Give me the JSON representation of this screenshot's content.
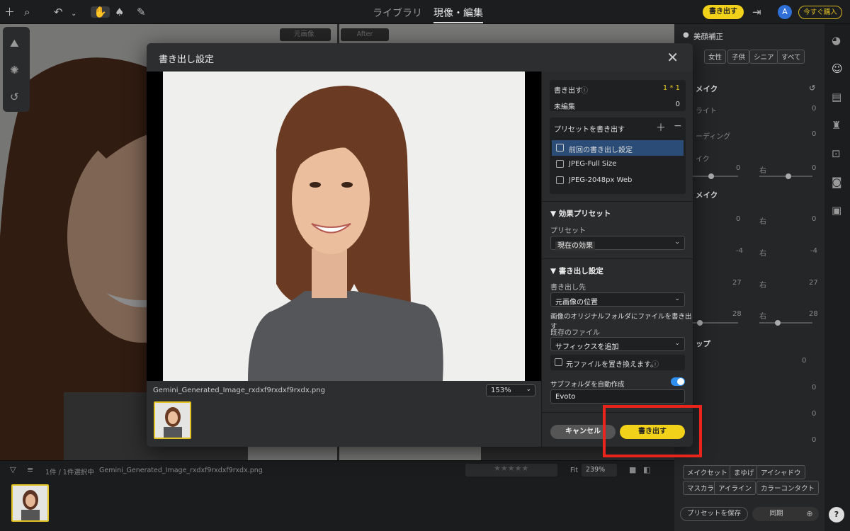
{
  "toolbar": {
    "tabs": [
      "ライブラリ",
      "現像・編集"
    ],
    "export_label": "書き出す",
    "avatar_letter": "A",
    "buy_label": "今すぐ購入"
  },
  "canvas": {
    "before_label": "元画像",
    "after_label": "After"
  },
  "dialog": {
    "title": "書き出し設定",
    "filename": "Gemini_Generated_Image_rxdxf9rxdxf9rxdx.png",
    "zoom": "153%",
    "export_count_label": "書き出す",
    "export_count_value": "1 * 1",
    "unedited_label": "未編集",
    "unedited_value": "0",
    "preset_header": "プリセットを書き出す",
    "presets": [
      "前回の書き出し設定",
      "JPEG-Full Size",
      "JPEG-2048px Web"
    ],
    "effect_section": "効果プリセット",
    "preset_label": "プリセット",
    "preset_value": "現在の効果",
    "export_section": "書き出し設定",
    "destination_label": "書き出し先",
    "destination_value": "元画像の位置",
    "destination_desc": "画像のオリジナルフォルダにファイルを書き出す",
    "existing_label": "既存のファイル",
    "existing_value": "サフィックスを追加",
    "overwrite_label": "元ファイルを置き換えます。",
    "subfolder_label": "サブフォルダを自動作成",
    "subfolder_value": "Evoto",
    "cancel": "キャンセル",
    "export": "書き出す"
  },
  "right_panel": {
    "title": "美顔補正",
    "chips": [
      "女性",
      "子供",
      "シニア",
      "すべて"
    ],
    "section1": "メイク",
    "rows": [
      {
        "label": "ライト",
        "value": "0"
      },
      {
        "label": "ーディング",
        "value": "0"
      },
      {
        "label": "イク",
        "value": "0"
      }
    ],
    "section2": "メイク",
    "pairs": [
      {
        "left": "0",
        "mid": "右",
        "right": "0"
      },
      {
        "left": "-4",
        "mid": "右",
        "right": "-4"
      },
      {
        "left": "27",
        "mid": "右",
        "right": "27"
      },
      {
        "left": "28",
        "mid": "右",
        "right": "28"
      }
    ],
    "section3": "ップ",
    "values3": [
      "0",
      "0",
      "0",
      "0"
    ],
    "tags_row1": [
      "メイクセット",
      "まゆげ",
      "アイシャドウ"
    ],
    "tags_row2": [
      "マスカラ",
      "アイライン",
      "カラーコンタクト"
    ],
    "save_preset": "プリセットを保存",
    "sync": "同期",
    "help": "?"
  },
  "bottom": {
    "selection": "1件 / 1件選択中",
    "filename": "Gemini_Generated_Image_rxdxf9rxdxf9rxdx.png",
    "fit": "Fit",
    "zoom": "239%"
  },
  "colors": {
    "accent": "#f2d11b",
    "highlight": "#e8241c",
    "toggle": "#2f8ff0",
    "selected_row": "#2b4c77"
  }
}
